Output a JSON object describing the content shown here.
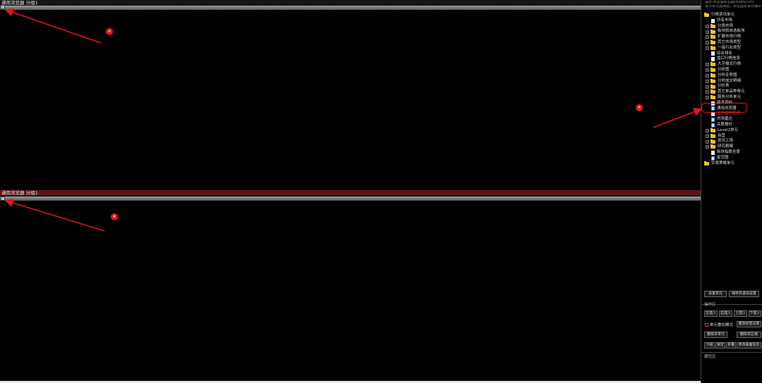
{
  "panes": {
    "top": {
      "title": "通用浏览器 分组1",
      "button": "1"
    },
    "bottom": {
      "title": "通用浏览器 分组1",
      "button": "1"
    }
  },
  "markers": [
    "①",
    "①",
    "②"
  ],
  "side": {
    "hint_lines": [
      "提示:点击鼠标右键(长按住Ctrl)",
      "进行单元选择后，单击选定单元格中选择"
    ],
    "tree": [
      {
        "label": "行情资讯单元",
        "type": "folder",
        "level": 0
      },
      {
        "label": "所有市场",
        "type": "doc",
        "level": 1
      },
      {
        "label": "分类市场",
        "type": "folder",
        "level": 1,
        "exp": "+"
      },
      {
        "label": "板块和自选板块",
        "type": "folder",
        "level": 1,
        "exp": "+"
      },
      {
        "label": "扩展市场行情",
        "type": "folder",
        "level": 1,
        "exp": "+"
      },
      {
        "label": "其它市场类型",
        "type": "folder",
        "level": 1,
        "exp": "+"
      },
      {
        "label": "一级行业类型",
        "type": "folder",
        "level": 1,
        "exp": "+"
      },
      {
        "label": "综合排名",
        "type": "doc",
        "level": 1
      },
      {
        "label": "盘口行情信息",
        "type": "doc",
        "level": 1
      },
      {
        "label": "大字报式行情",
        "type": "folder",
        "level": 1,
        "exp": "+"
      },
      {
        "label": "分析图",
        "type": "folder",
        "level": 1,
        "exp": "+"
      },
      {
        "label": "分时走势图",
        "type": "folder",
        "level": 1,
        "exp": "+"
      },
      {
        "label": "分时成交明细",
        "type": "folder",
        "level": 1,
        "exp": "+"
      },
      {
        "label": "分价表",
        "type": "folder",
        "level": 1,
        "exp": "+"
      },
      {
        "label": "其它单品种单元",
        "type": "folder",
        "level": 1,
        "exp": "+"
      },
      {
        "label": "服务分析单元",
        "type": "folder",
        "level": 1,
        "exp": "+"
      },
      {
        "label": "基本资料",
        "type": "doc",
        "level": 1
      },
      {
        "label": "通用浏览器",
        "type": "doc-blue",
        "level": 1
      },
      {
        "label": "主力监控精灵",
        "type": "doc",
        "level": 1,
        "red": true
      },
      {
        "label": "市场雷达",
        "type": "doc-blue",
        "level": 1
      },
      {
        "label": "关联报价",
        "type": "doc-blue",
        "level": 1
      },
      {
        "label": "Level2单元",
        "type": "folder",
        "level": 1,
        "exp": "+"
      },
      {
        "label": "自营",
        "type": "folder",
        "level": 1,
        "exp": "+"
      },
      {
        "label": "资讯工场",
        "type": "folder",
        "level": 1,
        "exp": "+"
      },
      {
        "label": "研究精编",
        "type": "folder",
        "level": 1,
        "exp": "+"
      },
      {
        "label": "板块指数全景",
        "type": "doc",
        "level": 1
      },
      {
        "label": "星空图",
        "type": "doc-blue",
        "level": 1
      },
      {
        "label": "交易策略单元",
        "type": "folder",
        "level": 0
      }
    ],
    "buttons_top": [
      "设置单元",
      "保存并退出设置"
    ],
    "op_section": "操作区",
    "insert_buttons": [
      "左插入",
      "右插入",
      "上插入",
      "下插入"
    ],
    "overlay_label": "单元叠加模式",
    "overlay_settings": "叠加标签设置",
    "delete_buttons": [
      "删除本单元",
      "删除本区域"
    ],
    "bottom_buttons": [
      "分组",
      "锁定",
      "折叠",
      "修改版面信息"
    ],
    "prop_section": "属性区"
  },
  "colors": {
    "accent_red": "#e0161d",
    "active_pane_title": "#5a1417",
    "folder": "#f2c12e"
  }
}
